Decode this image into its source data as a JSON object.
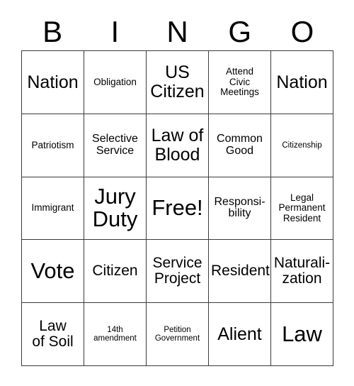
{
  "card": {
    "header_letters": [
      "B",
      "I",
      "N",
      "G",
      "O"
    ],
    "columns": 5,
    "rows": 5,
    "border_color": "#3a3a3a",
    "text_color": "#000000",
    "background_color": "#ffffff",
    "free_space_label": "Free!",
    "free_space_position": {
      "row": 3,
      "col": 3
    },
    "cells": [
      [
        {
          "text": "Nation",
          "size": "lg"
        },
        {
          "text": "Obligation",
          "size": "xs"
        },
        {
          "text": "US\nCitizen",
          "size": "lg"
        },
        {
          "text": "Attend\nCivic\nMeetings",
          "size": "xs"
        },
        {
          "text": "Nation",
          "size": "lg"
        }
      ],
      [
        {
          "text": "Patriotism",
          "size": "xs"
        },
        {
          "text": "Selective\nService",
          "size": "sm"
        },
        {
          "text": "Law of\nBlood",
          "size": "lg"
        },
        {
          "text": "Common\nGood",
          "size": "sm"
        },
        {
          "text": "Citizenship",
          "size": "xxs"
        }
      ],
      [
        {
          "text": "Immigrant",
          "size": "xs"
        },
        {
          "text": "Jury\nDuty",
          "size": "xl"
        },
        {
          "text": "Free!",
          "size": "xl"
        },
        {
          "text": "Responsi-\nbility",
          "size": "sm"
        },
        {
          "text": "Legal\nPermanent\nResident",
          "size": "xs"
        }
      ],
      [
        {
          "text": "Vote",
          "size": "xl"
        },
        {
          "text": "Citizen",
          "size": "md"
        },
        {
          "text": "Service\nProject",
          "size": "md"
        },
        {
          "text": "Resident",
          "size": "md"
        },
        {
          "text": "Naturali-\nzation",
          "size": "md"
        }
      ],
      [
        {
          "text": "Law\nof Soil",
          "size": "md"
        },
        {
          "text": "14th\namendment",
          "size": "xxs"
        },
        {
          "text": "Petition\nGovernment",
          "size": "xxs"
        },
        {
          "text": "Alient",
          "size": "lg"
        },
        {
          "text": "Law",
          "size": "xl"
        }
      ]
    ]
  }
}
